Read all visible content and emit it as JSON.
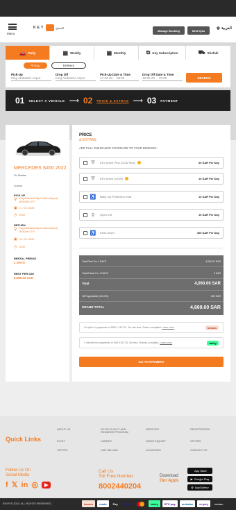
{
  "header": {
    "menu_label": "Menu",
    "logo_text": "KEY",
    "logo_ar": "المفتاح",
    "manage_booking": "Manage Booking",
    "user_name": "Mhd Ilyas",
    "language": "العربية"
  },
  "tabs": [
    {
      "label": "Daily",
      "icon": "car-icon"
    },
    {
      "label": "Weekly",
      "icon": "calendar-week-icon"
    },
    {
      "label": "Monthly",
      "icon": "calendar-month-icon"
    },
    {
      "label": "Key Subscription",
      "icon": "subscription-icon"
    },
    {
      "label": "Shefaki",
      "icon": "chauffeur-icon"
    }
  ],
  "mode_pills": [
    "Pickup",
    "Delivery"
  ],
  "booking_form": {
    "pickup_label": "Pick-Up",
    "pickup_value": "King Abdulaziz Airpor",
    "dropoff_label": "Drop Off",
    "dropoff_value": "King Abdulaziz Airpor",
    "pickup_datetime_label": "Pick-Up Date & Time",
    "pickup_date": "17-02-20",
    "pickup_time": "09:00",
    "dropoff_datetime_label": "Drop Off Date & Time",
    "dropoff_date": "18-02-20",
    "dropoff_time": "20:00",
    "search_label": "SEARCH"
  },
  "steps": [
    {
      "num": "01",
      "label": "SELECT A VEHICLE"
    },
    {
      "num": "02",
      "label": "PRICE & EXTRAS"
    },
    {
      "num": "03",
      "label": "PAYMENT"
    }
  ],
  "vehicle": {
    "name": "MERCEDES S450 2022",
    "similar": "Or Similar",
    "class": "Luxury",
    "pickup_heading": "PICK UP",
    "pickup_location": "King Abdulaziz Airport (New Airport) JEDDAH CITY",
    "pickup_date": "17 / 02 / 2023",
    "pickup_time": "09:00",
    "return_heading": "RETURN",
    "return_location": "King Abdulaziz Airport (New Airport) JEDDAH CITY",
    "return_date": "18 / 02 / 2023",
    "return_time": "20:00",
    "rental_period_label": "RENTAL PERIOD",
    "rental_period_value": "1 DAYS",
    "rent_per_day_label": "RENT PER DAY",
    "rent_per_day_value": "4,060.00 SAR"
  },
  "price": {
    "title": "PRICE",
    "subtitle": "& EXTRAS",
    "coverage_heading": "ADD FULL INSURANCE COVERAGE TO YOUR BOOKING:",
    "options": [
      {
        "name": "KEY Armor Plus (CDW Plus)",
        "price": "60 SAR Per Day",
        "icon": "shield-plus-icon",
        "info": true
      },
      {
        "name": "KEY Armor (CDW)",
        "price": "10 SAR Per Day",
        "icon": "shield-icon",
        "info": true
      },
      {
        "name": "Baby Car Protection Seat",
        "price": "10 SAR Per Day",
        "icon": "baby-seat-icon",
        "info": false
      },
      {
        "name": "Open KM",
        "price": "10 SAR Per Day",
        "icon": "location-pin-icon",
        "info": false
      },
      {
        "name": "Extra Driver",
        "price": "400 SAR Per Day",
        "icon": "extra-driver-icon",
        "info": false
      }
    ]
  },
  "summary": {
    "total_rent_label": "Total Rent For 1 DAYS",
    "total_rent_value": "4,060.00 SAR",
    "total_extras_label": "Total Extras For 1 DAYS",
    "total_extras_value": "0 SAR",
    "total_label": "Total",
    "total_value": "4,060.00 SAR",
    "vat_label": "VAT Applicable (15.00%)",
    "vat_value": "609 SAR",
    "grand_total_label": "GRAND TOTAL",
    "grand_total_value": "4,669.00 SAR"
  },
  "installments": [
    {
      "text": "Or split in 4 payments of SAR 1,167.25 - No late fees, Sharia compliant!",
      "link": "Learn more",
      "brand": "tamara"
    },
    {
      "text": "4 interest-free payments of SAR 1167.25. No fees. Shariah-compliant.",
      "link": "Learn more",
      "brand": "tabby"
    }
  ],
  "goto_payment": "GO TO PAYMENT",
  "footer": {
    "quick_links_title": "Quick Links",
    "links": [
      "ABOUT US",
      "KEYS LOYALTY AND REWARDS PROGRAM",
      "SERVICES",
      "REGISTRATION",
      "FLEET",
      "CAREER",
      "LEASE INQUIRY",
      "OFFERS",
      "OFFERS",
      "CAR SELLING",
      "LOCATIONS",
      "CONTACT US"
    ],
    "follow_us": "Follow Us On",
    "social_media": "Social Media",
    "call_us": "Call Us",
    "toll_free": "Toll Free Number",
    "phone": "8002440204",
    "download": "Download",
    "our_apps": "Our Apps",
    "app_store": "App Store",
    "google_play": "Google Play",
    "app_gallery": "AppGallery",
    "copyright": "RIGHTS 2023. ALL RIGHTS RESERVED.",
    "payments": [
      "tamara",
      "mada",
      "Pay",
      "VISA",
      "mastercard",
      "tabby",
      "STC pay",
      "mokafaa",
      "neqaty",
      "emkan"
    ]
  },
  "colors": {
    "accent": "#f47b20",
    "dark": "#202020",
    "summary_bg": "#6e6e6e"
  }
}
